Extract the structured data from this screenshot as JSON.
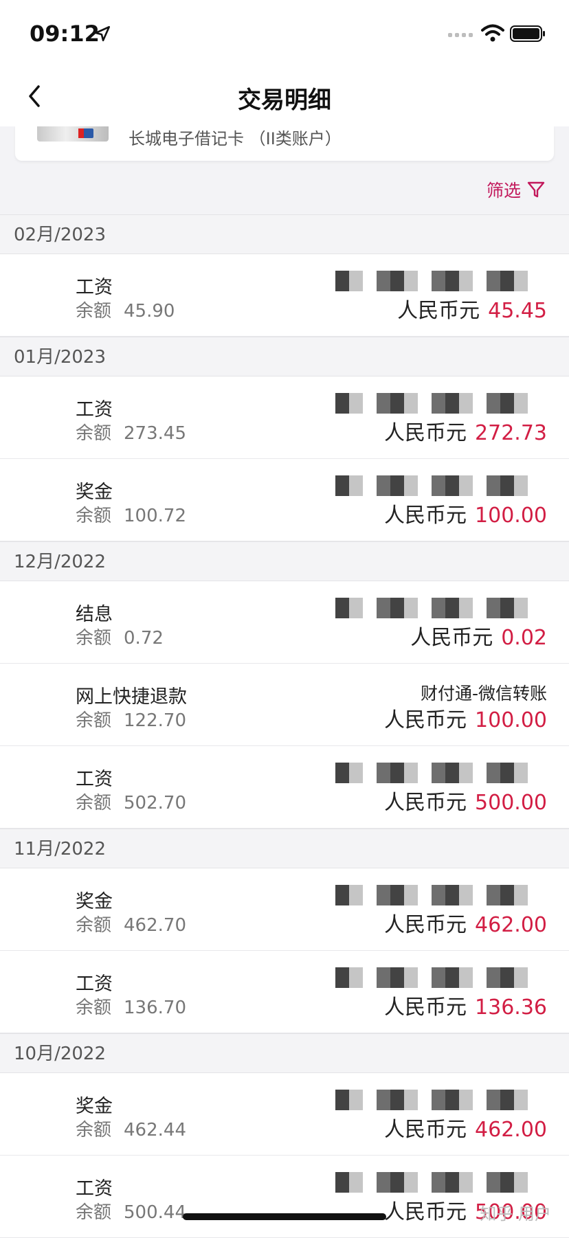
{
  "status": {
    "time": "09:12"
  },
  "nav": {
    "title": "交易明细"
  },
  "account": {
    "name": "长城电子借记卡 （II类账户）"
  },
  "filter": {
    "label": "筛选"
  },
  "balance_label": "余额",
  "currency": "人民币元",
  "groups": [
    {
      "month": "02月/2023",
      "items": [
        {
          "type": "工资",
          "balance": "45.90",
          "counterparty": "",
          "amount": "45.45"
        }
      ]
    },
    {
      "month": "01月/2023",
      "items": [
        {
          "type": "工资",
          "balance": "273.45",
          "counterparty": "",
          "amount": "272.73"
        },
        {
          "type": "奖金",
          "balance": "100.72",
          "counterparty": "",
          "amount": "100.00"
        }
      ]
    },
    {
      "month": "12月/2022",
      "items": [
        {
          "type": "结息",
          "balance": "0.72",
          "counterparty": "",
          "amount": "0.02"
        },
        {
          "type": "网上快捷退款",
          "balance": "122.70",
          "counterparty": "财付通-微信转账",
          "amount": "100.00"
        },
        {
          "type": "工资",
          "balance": "502.70",
          "counterparty": "",
          "amount": "500.00"
        }
      ]
    },
    {
      "month": "11月/2022",
      "items": [
        {
          "type": "奖金",
          "balance": "462.70",
          "counterparty": "",
          "amount": "462.00"
        },
        {
          "type": "工资",
          "balance": "136.70",
          "counterparty": "",
          "amount": "136.36"
        }
      ]
    },
    {
      "month": "10月/2022",
      "items": [
        {
          "type": "奖金",
          "balance": "462.44",
          "counterparty": "",
          "amount": "462.00"
        },
        {
          "type": "工资",
          "balance": "500.44",
          "counterparty": "",
          "amount": "500.00"
        }
      ]
    }
  ],
  "watermark": "知乎 用户",
  "colors": {
    "accent": "#d21e44",
    "filter": "#c2185b"
  }
}
